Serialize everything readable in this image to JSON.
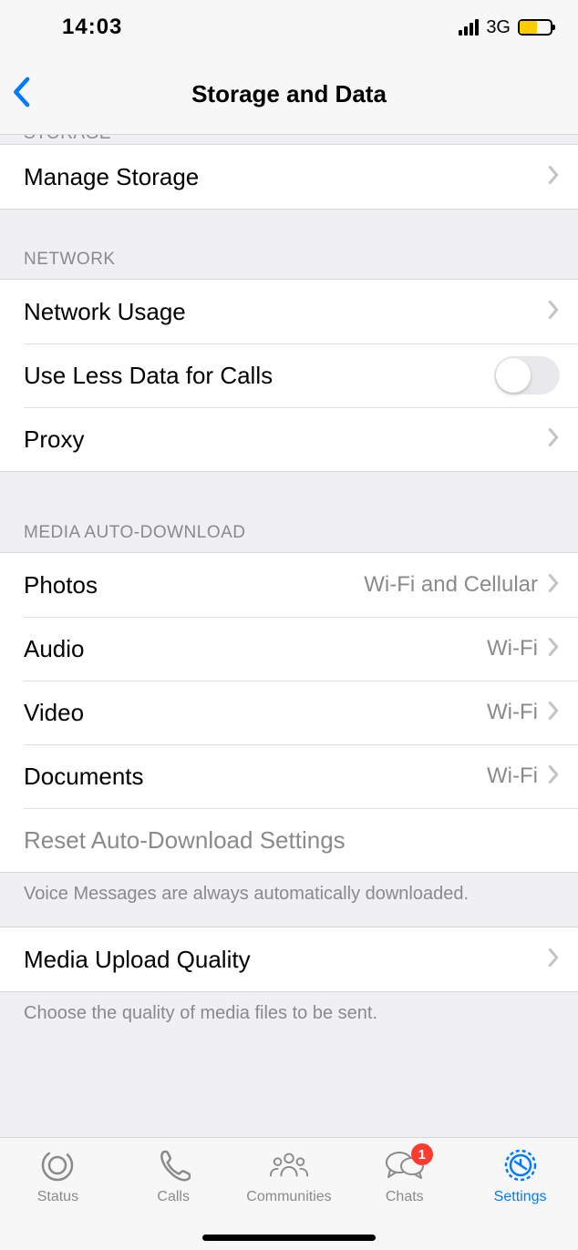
{
  "statusbar": {
    "time": "14:03",
    "network_label": "3G"
  },
  "header": {
    "title": "Storage and Data"
  },
  "sections": {
    "storage": {
      "header": "STORAGE",
      "manage": "Manage Storage"
    },
    "network": {
      "header": "NETWORK",
      "usage": "Network Usage",
      "less_data": "Use Less Data for Calls",
      "proxy": "Proxy"
    },
    "media": {
      "header": "MEDIA AUTO-DOWNLOAD",
      "photos_label": "Photos",
      "photos_value": "Wi-Fi and Cellular",
      "audio_label": "Audio",
      "audio_value": "Wi-Fi",
      "video_label": "Video",
      "video_value": "Wi-Fi",
      "documents_label": "Documents",
      "documents_value": "Wi-Fi",
      "reset": "Reset Auto-Download Settings",
      "note": "Voice Messages are always automatically downloaded."
    },
    "upload": {
      "label": "Media Upload Quality",
      "note": "Choose the quality of media files to be sent."
    }
  },
  "tabs": {
    "status": "Status",
    "calls": "Calls",
    "communities": "Communities",
    "chats": "Chats",
    "chats_badge": "1",
    "settings": "Settings"
  }
}
